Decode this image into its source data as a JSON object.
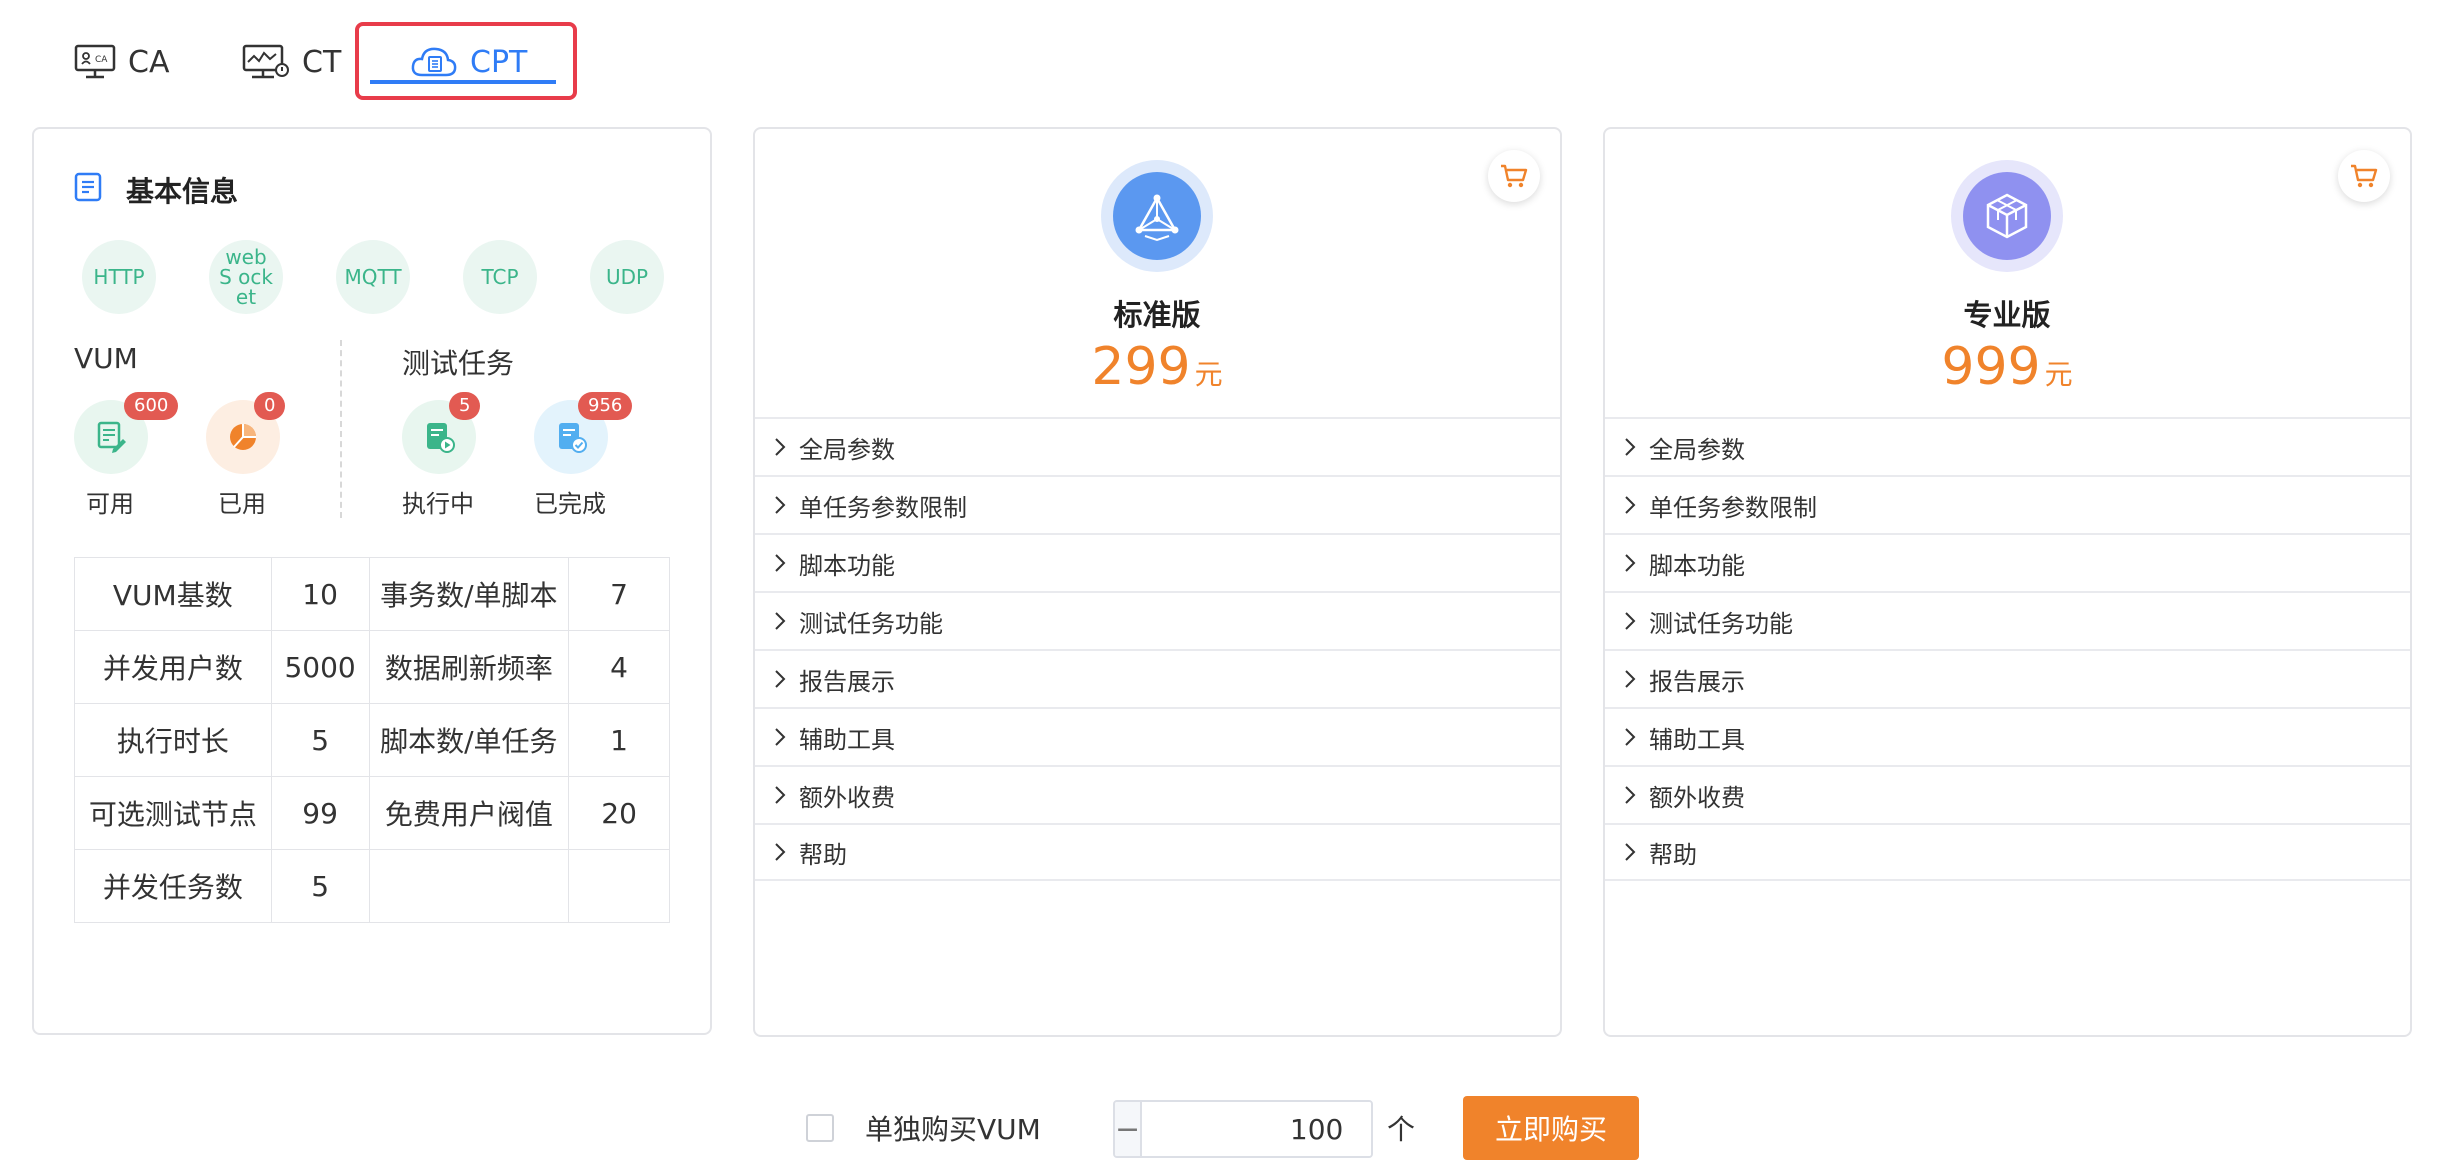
{
  "tabs": [
    {
      "label": "CA",
      "active": false
    },
    {
      "label": "CT",
      "active": false
    },
    {
      "label": "CPT",
      "active": true
    }
  ],
  "basic_info": {
    "title": "基本信息",
    "protocols": [
      "HTTP",
      "webS ocket",
      "MQTT",
      "TCP",
      "UDP"
    ],
    "vum": {
      "title": "VUM",
      "available": {
        "label": "可用",
        "count": "600"
      },
      "used": {
        "label": "已用",
        "count": "0"
      }
    },
    "tasks": {
      "title": "测试任务",
      "running": {
        "label": "执行中",
        "count": "5"
      },
      "done": {
        "label": "已完成",
        "count": "956"
      }
    },
    "table": [
      [
        "VUM基数",
        "10",
        "事务数/单脚本",
        "7"
      ],
      [
        "并发用户数",
        "5000",
        "数据刷新频率",
        "4"
      ],
      [
        "执行时长",
        "5",
        "脚本数/单任务",
        "1"
      ],
      [
        "可选测试节点",
        "99",
        "免费用户阀值",
        "20"
      ],
      [
        "并发任务数",
        "5",
        "",
        ""
      ]
    ]
  },
  "plans": [
    {
      "name": "标准版",
      "price": "299",
      "unit": "元",
      "features": [
        "全局参数",
        "单任务参数限制",
        "脚本功能",
        "测试任务功能",
        "报告展示",
        "辅助工具",
        "额外收费",
        "帮助"
      ]
    },
    {
      "name": "专业版",
      "price": "999",
      "unit": "元",
      "features": [
        "全局参数",
        "单任务参数限制",
        "脚本功能",
        "测试任务功能",
        "报告展示",
        "辅助工具",
        "额外收费",
        "帮助"
      ]
    }
  ],
  "purchase": {
    "checkbox_label": "单独购买VUM",
    "quantity": "100",
    "minus": "−",
    "plus": "+",
    "unit": "个",
    "buy_label": "立即购买"
  },
  "colors": {
    "accent": "#2f7cf6",
    "price": "#f0832b",
    "protocol": "#3bb58a",
    "badge": "#e25a52"
  }
}
